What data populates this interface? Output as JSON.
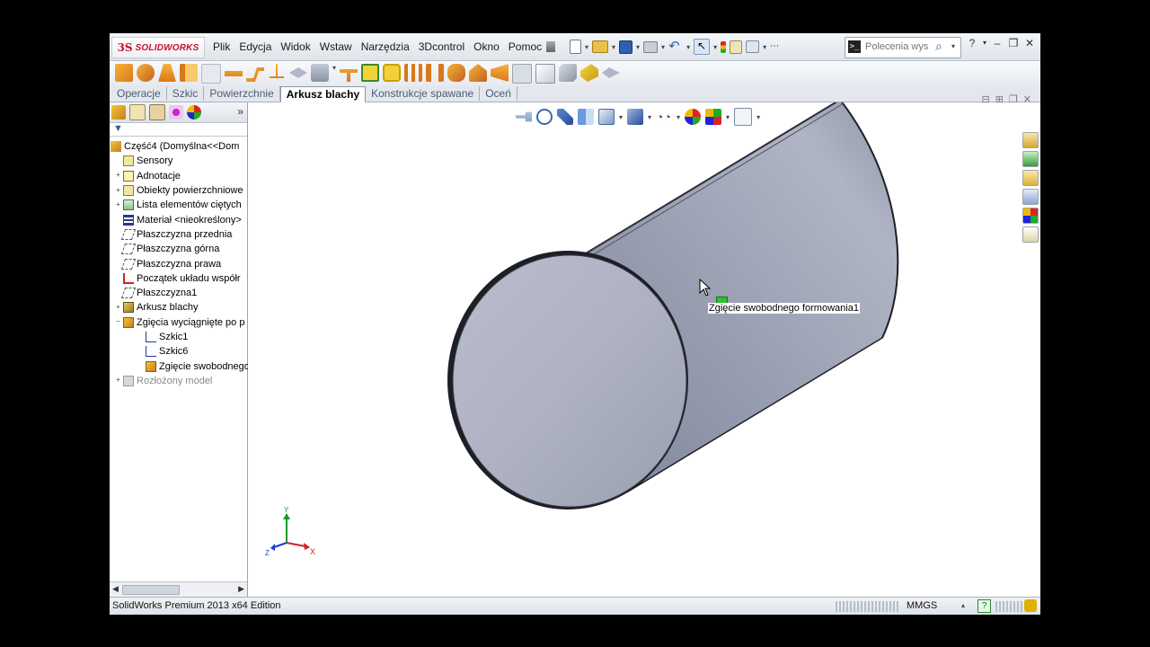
{
  "app": {
    "logo_symbol": "3S",
    "logo_text": "SOLIDWORKS"
  },
  "menu": [
    "Plik",
    "Edycja",
    "Widok",
    "Wstaw",
    "Narzędzia",
    "3Dcontrol",
    "Okno",
    "Pomoc"
  ],
  "search": {
    "placeholder": "Polecenia wys"
  },
  "tabs": [
    {
      "label": "Operacje",
      "active": false
    },
    {
      "label": "Szkic",
      "active": false
    },
    {
      "label": "Powierzchnie",
      "active": false
    },
    {
      "label": "Arkusz blachy",
      "active": true
    },
    {
      "label": "Konstrukcje spawane",
      "active": false
    },
    {
      "label": "Oceń",
      "active": false
    }
  ],
  "tree": {
    "root": "Część4  (Domyślna<<Dom",
    "items": [
      {
        "label": "Sensory",
        "indent": 1,
        "expander": ""
      },
      {
        "label": "Adnotacje",
        "indent": 1,
        "expander": "+"
      },
      {
        "label": "Obiekty powierzchniowe",
        "indent": 1,
        "expander": "+"
      },
      {
        "label": "Lista elementów ciętych",
        "indent": 1,
        "expander": "+"
      },
      {
        "label": "Materiał <nieokreślony>",
        "indent": 1,
        "expander": ""
      },
      {
        "label": "Płaszczyzna przednia",
        "indent": 1,
        "expander": ""
      },
      {
        "label": "Płaszczyzna górna",
        "indent": 1,
        "expander": ""
      },
      {
        "label": "Płaszczyzna prawa",
        "indent": 1,
        "expander": ""
      },
      {
        "label": "Początek układu współr",
        "indent": 1,
        "expander": ""
      },
      {
        "label": "Płaszczyzna1",
        "indent": 1,
        "expander": ""
      },
      {
        "label": "Arkusz blachy",
        "indent": 1,
        "expander": "+"
      },
      {
        "label": "Zgięcia wyciągnięte po p",
        "indent": 1,
        "expander": "−"
      },
      {
        "label": "Szkic1",
        "indent": 2,
        "expander": ""
      },
      {
        "label": "Szkic6",
        "indent": 2,
        "expander": ""
      },
      {
        "label": "Zgięcie swobodnego",
        "indent": 2,
        "expander": ""
      },
      {
        "label": "Rozłożony model",
        "indent": 1,
        "expander": "+",
        "disabled": true
      }
    ]
  },
  "viewport": {
    "tooltip": "Zgięcie swobodnego formowania1",
    "triad": {
      "x": "X",
      "y": "Y",
      "z": "Z"
    }
  },
  "status": {
    "text": "SolidWorks Premium 2013 x64 Edition",
    "units": "MMGS",
    "help": "?"
  },
  "colors": {
    "brand": "#c8102e",
    "model": "#9096a8",
    "axis_x": "#d62020",
    "axis_y": "#1a9a2a",
    "axis_z": "#1a3fd0"
  }
}
